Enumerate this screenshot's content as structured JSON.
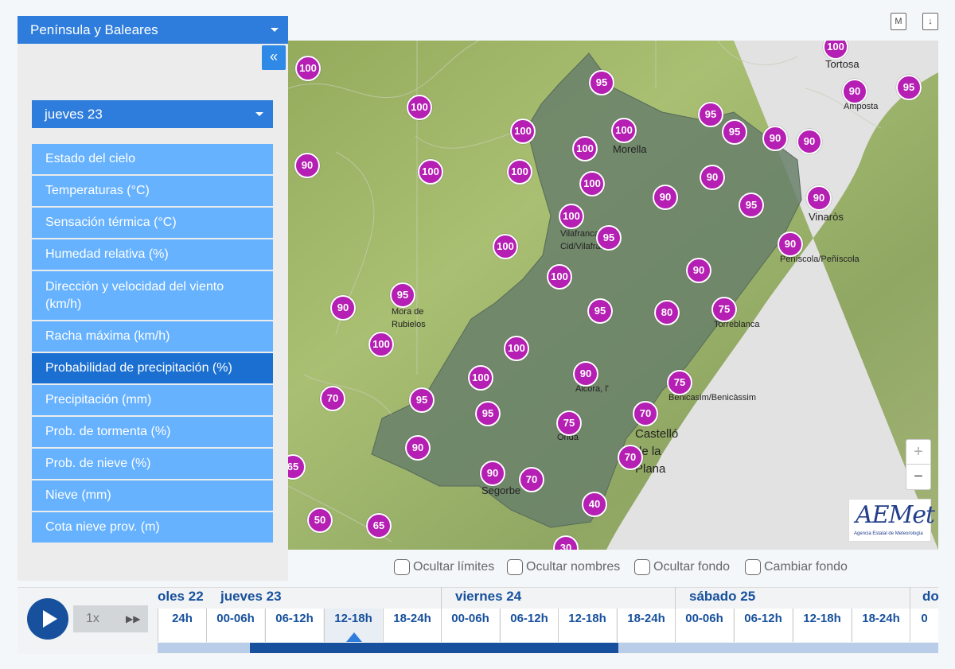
{
  "panel": {
    "region": "Península y Baleares",
    "collapse": "«",
    "day": "jueves 23",
    "menu": [
      "Estado del cielo",
      "Temperaturas (°C)",
      "Sensación térmica (°C)",
      "Humedad relativa (%)",
      "Dirección y velocidad del viento (km/h)",
      "Racha máxima (km/h)",
      "Probabilidad de precipitación (%)",
      "Precipitación (mm)",
      "Prob. de tormenta (%)",
      "Prob. de nieve (%)",
      "Nieve (mm)",
      "Cota nieve prov. (m)"
    ],
    "active_item": "Probabilidad de precipitación (%)"
  },
  "map": {
    "top_icons": [
      "M",
      "↓"
    ],
    "places": {
      "tortosa": "Tortosa",
      "amposta": "Amposta",
      "morella": "Morella",
      "vinaros": "Vinaròs",
      "vilafranca": "Vilafranca del Cid/Vilafranca",
      "peniscola": "Peníscola/Peñíscola",
      "mora": "Mora de Rubielos",
      "torreblanca": "Torreblanca",
      "alcora": "Alcora, l'",
      "benicasim": "Benicasim/Benicàssim",
      "onda": "Onda",
      "castello": "Castelló de la Plana",
      "segorbe": "Segorbe"
    },
    "values": [
      "100",
      "100",
      "90",
      "95",
      "95",
      "100",
      "100",
      "95",
      "100",
      "100",
      "95",
      "90",
      "90",
      "90",
      "100",
      "100",
      "100",
      "100",
      "90",
      "90",
      "95",
      "90",
      "100",
      "100",
      "95",
      "90",
      "100",
      "95",
      "95",
      "80",
      "75",
      "90",
      "90",
      "100",
      "100",
      "90",
      "75",
      "70",
      "95",
      "95",
      "75",
      "70",
      "90",
      "90",
      "70",
      "70",
      "65",
      "40",
      "50",
      "65",
      "30"
    ],
    "zoom_in": "+",
    "zoom_out": "−",
    "logo": "AEMet",
    "logo_sub": "Agencia Estatal de Meteorología"
  },
  "options": [
    "Ocultar límites",
    "Ocultar nombres",
    "Ocultar fondo",
    "Cambiar fondo"
  ],
  "player": {
    "speed": "1x",
    "forward": "▶▶",
    "days": [
      "oles 22",
      "jueves 23",
      "viernes 24",
      "sábado 25",
      "do"
    ],
    "slots": [
      "24h",
      "00-06h",
      "06-12h",
      "12-18h",
      "18-24h",
      "00-06h",
      "06-12h",
      "12-18h",
      "18-24h",
      "00-06h",
      "06-12h",
      "12-18h",
      "18-24h",
      "0"
    ],
    "selected_slot": "12-18h"
  },
  "colors": {
    "accent": "#2e7ddc",
    "menu": "#66b2ff",
    "menu_active": "#1a6fd1",
    "marker": "#b51fb3",
    "timeline": "#17509c"
  }
}
